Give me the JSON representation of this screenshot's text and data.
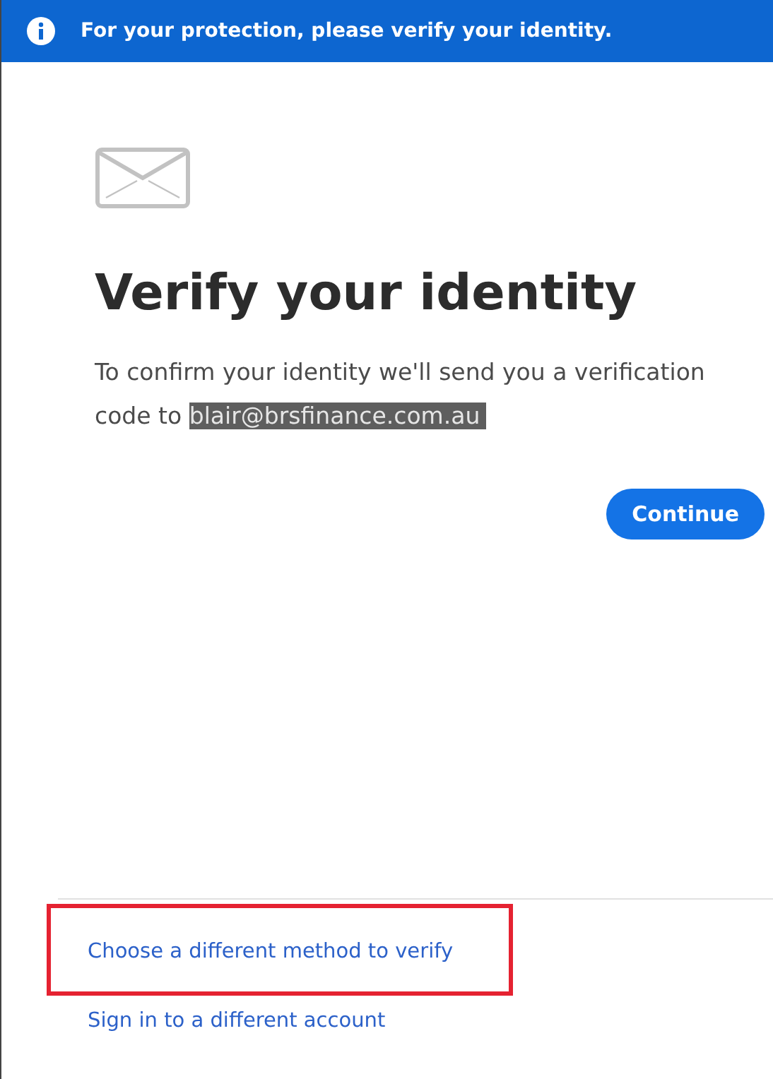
{
  "banner": {
    "message": "For your protection, please verify your identity."
  },
  "heading": "Verify your identity",
  "description": {
    "text": "To confirm your identity we'll send you a verification code to",
    "email": "blair@brsfinance.com.au"
  },
  "continue_button": "Continue",
  "links": [
    {
      "label": "Choose a different method to verify",
      "highlighted": true
    },
    {
      "label": "Sign in to a different account",
      "highlighted": false
    }
  ]
}
